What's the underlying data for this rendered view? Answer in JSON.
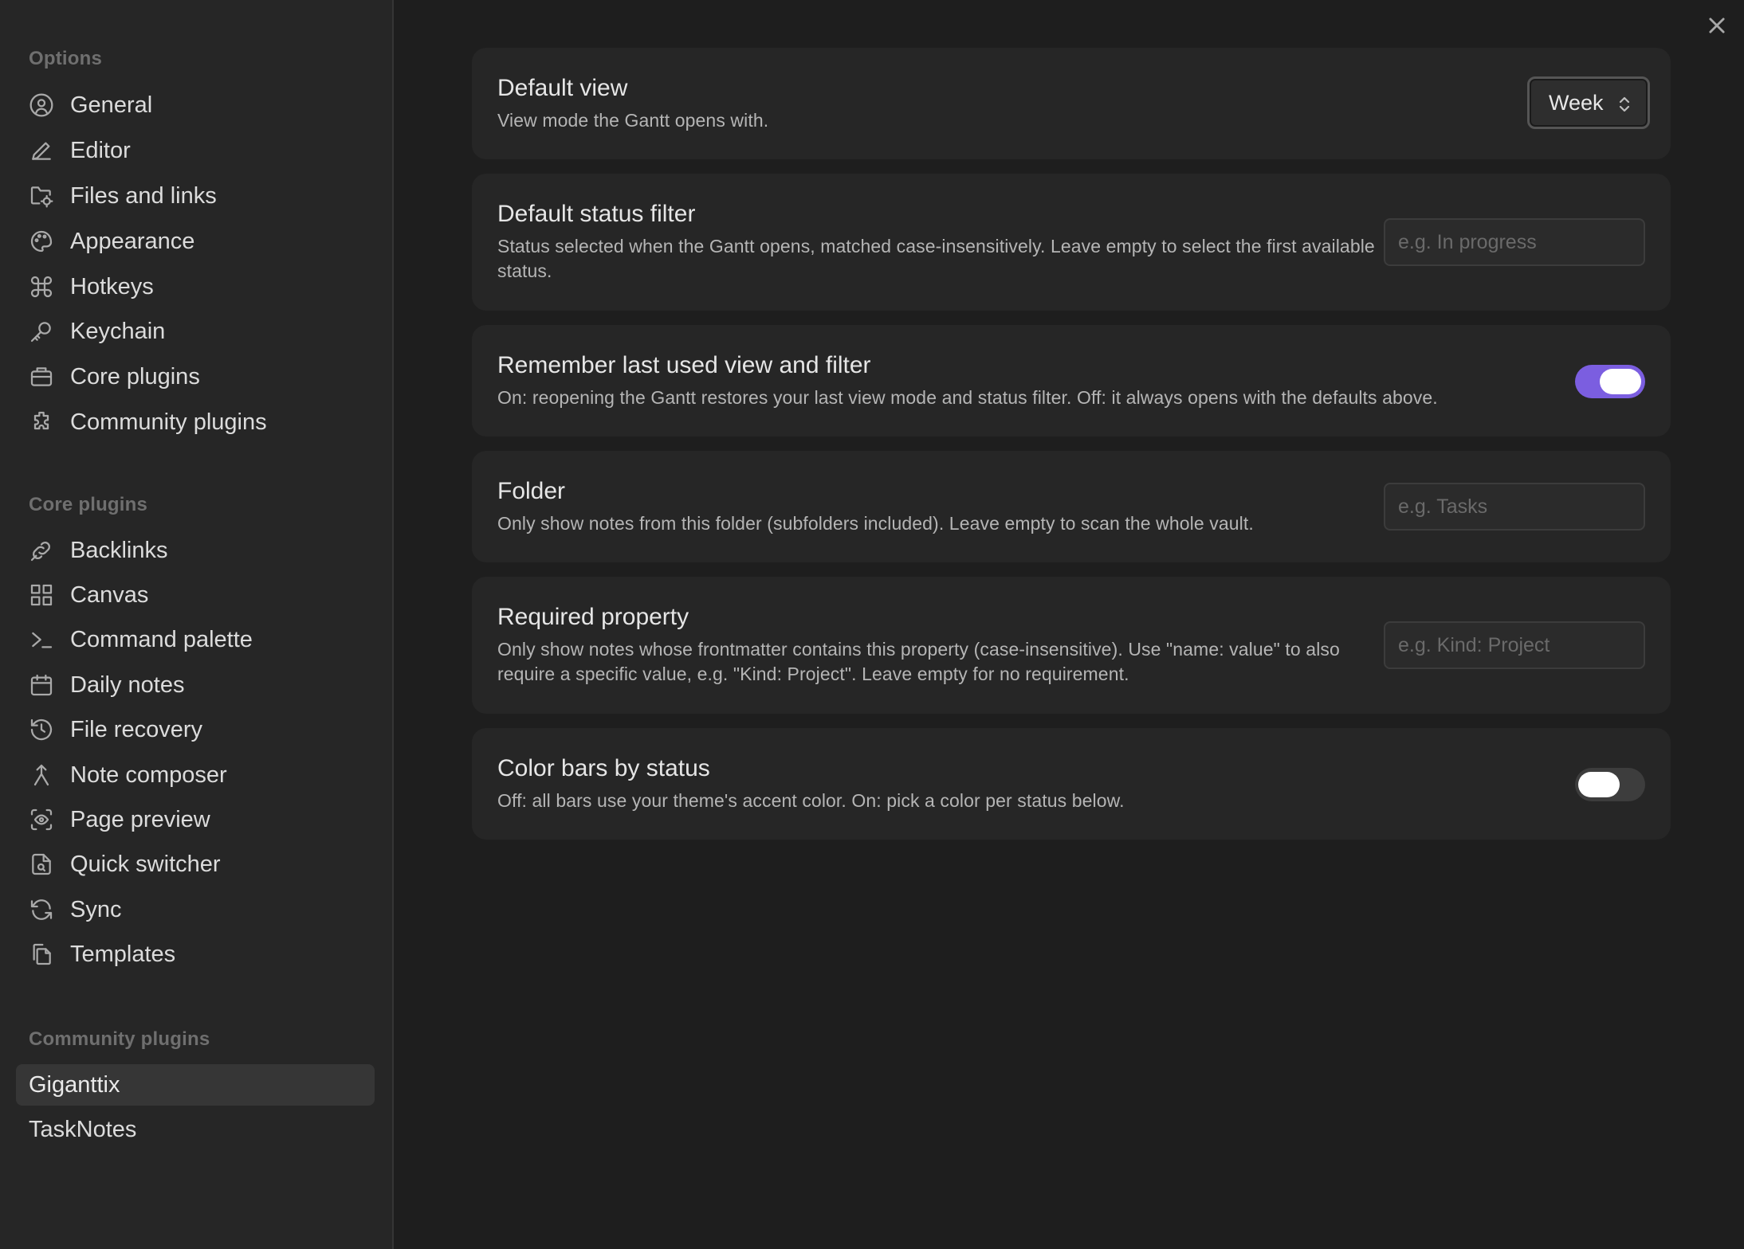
{
  "sidebar": {
    "options_title": "Options",
    "options": [
      {
        "label": "General",
        "icon": "user-circle-icon"
      },
      {
        "label": "Editor",
        "icon": "pencil-icon"
      },
      {
        "label": "Files and links",
        "icon": "folder-cog-icon"
      },
      {
        "label": "Appearance",
        "icon": "palette-icon"
      },
      {
        "label": "Hotkeys",
        "icon": "command-icon"
      },
      {
        "label": "Keychain",
        "icon": "key-icon"
      },
      {
        "label": "Core plugins",
        "icon": "briefcase-icon"
      },
      {
        "label": "Community plugins",
        "icon": "puzzle-icon"
      }
    ],
    "core_title": "Core plugins",
    "core_plugins": [
      {
        "label": "Backlinks",
        "icon": "backlink-icon"
      },
      {
        "label": "Canvas",
        "icon": "layout-dashboard-icon"
      },
      {
        "label": "Command palette",
        "icon": "terminal-icon"
      },
      {
        "label": "Daily notes",
        "icon": "calendar-icon"
      },
      {
        "label": "File recovery",
        "icon": "history-icon"
      },
      {
        "label": "Note composer",
        "icon": "merge-icon"
      },
      {
        "label": "Page preview",
        "icon": "eye-scan-icon"
      },
      {
        "label": "Quick switcher",
        "icon": "file-search-icon"
      },
      {
        "label": "Sync",
        "icon": "refresh-icon"
      },
      {
        "label": "Templates",
        "icon": "copy-files-icon"
      }
    ],
    "community_title": "Community plugins",
    "community_plugins": [
      {
        "label": "Giganttix",
        "active": true
      },
      {
        "label": "TaskNotes",
        "active": false
      }
    ]
  },
  "settings": {
    "default_view": {
      "name": "Default view",
      "desc": "View mode the Gantt opens with.",
      "value": "Week"
    },
    "status_filter": {
      "name": "Default status filter",
      "desc": "Status selected when the Gantt opens, matched case-insensitively. Leave empty to select the first available status.",
      "placeholder": "e.g. In progress",
      "value": ""
    },
    "remember": {
      "name": "Remember last used view and filter",
      "desc": "On: reopening the Gantt restores your last view mode and status filter. Off: it always opens with the defaults above.",
      "enabled": true
    },
    "folder": {
      "name": "Folder",
      "desc": "Only show notes from this folder (subfolders included). Leave empty to scan the whole vault.",
      "placeholder": "e.g. Tasks",
      "value": ""
    },
    "required_property": {
      "name": "Required property",
      "desc": "Only show notes whose frontmatter contains this property (case-insensitive). Use \"name: value\" to also require a specific value, e.g. \"Kind: Project\". Leave empty for no requirement.",
      "placeholder": "e.g. Kind: Project",
      "value": ""
    },
    "color_bars": {
      "name": "Color bars by status",
      "desc": "Off: all bars use your theme's accent color. On: pick a color per status below.",
      "enabled": false
    }
  },
  "colors": {
    "accent": "#7b5ee0",
    "background": "#1e1e1e",
    "sidebar": "#262626",
    "card": "#262626"
  }
}
